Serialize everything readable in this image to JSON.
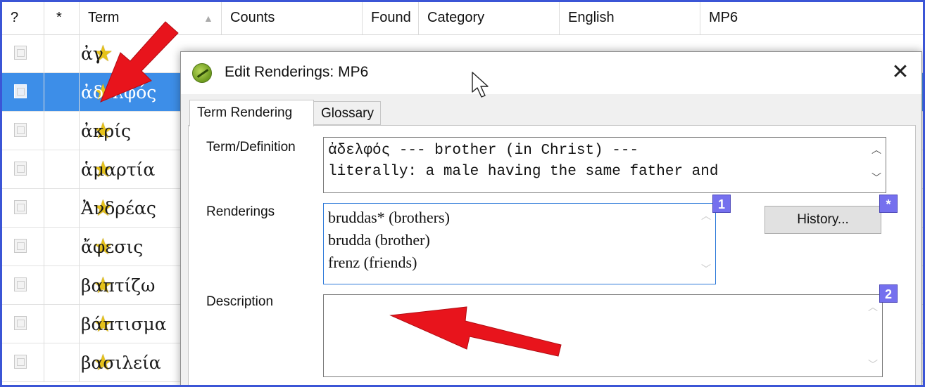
{
  "table": {
    "headers": {
      "col_q": "?",
      "col_star": "*",
      "col_term": "Term",
      "col_counts": "Counts",
      "col_found": "Found",
      "col_category": "Category",
      "col_english": "English",
      "col_mp6": "MP6"
    },
    "rows": [
      {
        "term": "ἀγ"
      },
      {
        "term": "ἀδελφός",
        "selected": true
      },
      {
        "term": "ἀκρίς"
      },
      {
        "term": "ἁμαρτία"
      },
      {
        "term": "Ἀνδρέας"
      },
      {
        "term": "ἄφεσις"
      },
      {
        "term": "βαπτίζω"
      },
      {
        "term": "βάπτισμα"
      },
      {
        "term": "βασιλεία"
      }
    ],
    "star_glyph": "★",
    "sort_icon": "sort-ascending-icon"
  },
  "dialog": {
    "title": "Edit Renderings: MP6",
    "close_glyph": "✕",
    "tabs": [
      {
        "label": "Term Rendering",
        "active": true
      },
      {
        "label": "Glossary",
        "active": false
      }
    ],
    "term_definition": {
      "label": "Term/Definition",
      "line1": "ἀδελφός --- brother (in Christ) ---",
      "line2": "literally: a male having the same father and"
    },
    "renderings": {
      "label": "Renderings",
      "items": [
        "bruddas* (brothers)",
        "brudda (brother)",
        "frenz (friends)"
      ],
      "badge": "1"
    },
    "history": {
      "button_label": "History...",
      "badge": "*"
    },
    "description": {
      "label": "Description",
      "value": "",
      "badge": "2"
    }
  },
  "colors": {
    "frame_border": "#3b55d6",
    "selected_row": "#3d8ee8",
    "badge": "#7570ee",
    "arrow": "#e8141c",
    "star": "#e6c21a"
  }
}
